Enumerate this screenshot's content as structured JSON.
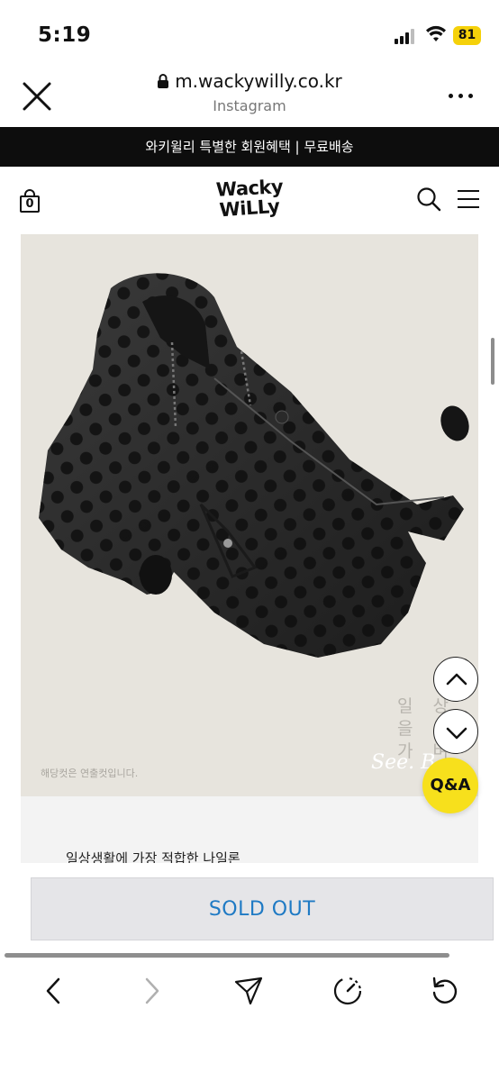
{
  "status_bar": {
    "time": "5:19",
    "battery": "81",
    "battery_color": "#f5d10a"
  },
  "browser": {
    "url": "m.wackywilly.co.kr",
    "subtitle": "Instagram",
    "close_icon": "close-icon",
    "more_icon": "more-icon"
  },
  "promo": {
    "text": "와키윌리 특별한 회원혜택 | 무료배송"
  },
  "site_header": {
    "cart_count": "0",
    "logo_line1": "Wacky",
    "logo_line2": "WiLLy",
    "icons": [
      "shopping-bag-icon",
      "search-icon",
      "menu-icon"
    ]
  },
  "product": {
    "image_caption": "해당컷은 연출컷입니다.",
    "side_text_line1": "일 상 을",
    "side_text_line2": "가 벼",
    "side_text_script": "See. B",
    "description_heading": "일상생활에 가장 적합한 나일론"
  },
  "floating": {
    "up_icon": "chevron-up-icon",
    "down_icon": "chevron-down-icon",
    "qa_label": "Q&A",
    "qa_color": "#f7e01c"
  },
  "purchase": {
    "sold_out_label": "SOLD OUT",
    "sold_out_color": "#1f7ac4"
  },
  "toolbar": {
    "icons": [
      "back-arrow-icon",
      "forward-arrow-icon",
      "share-icon",
      "speed-icon",
      "refresh-icon"
    ]
  }
}
